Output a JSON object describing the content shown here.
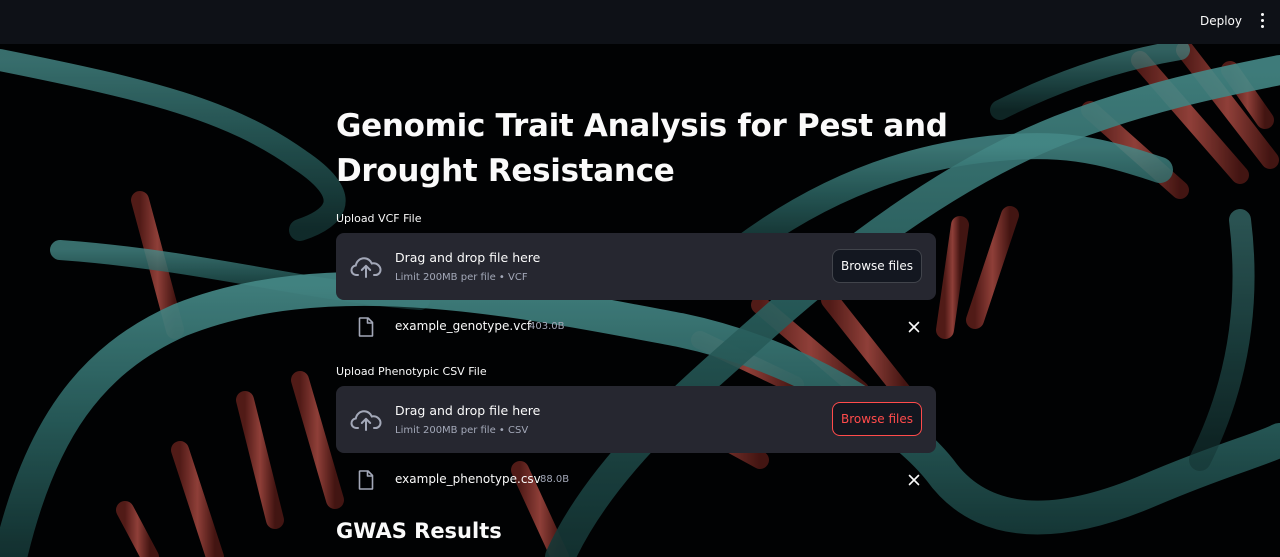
{
  "topbar": {
    "deploy_label": "Deploy",
    "menu_icon": "more-vertical-icon"
  },
  "page": {
    "title": "Genomic Trait Analysis for Pest and Drought Resistance",
    "accent_color": "#ff4b4b"
  },
  "uploads": [
    {
      "label": "Upload VCF File",
      "drop_text": "Drag and drop file here",
      "limit_text": "Limit 200MB per file • VCF",
      "button_label": "Browse files",
      "file": {
        "name": "example_genotype.vcf",
        "size": "403.0B"
      }
    },
    {
      "label": "Upload Phenotypic CSV File",
      "drop_text": "Drag and drop file here",
      "limit_text": "Limit 200MB per file • CSV",
      "button_label": "Browse files",
      "file": {
        "name": "example_phenotype.csv",
        "size": "88.0B"
      }
    }
  ],
  "results": {
    "heading": "GWAS Results"
  }
}
